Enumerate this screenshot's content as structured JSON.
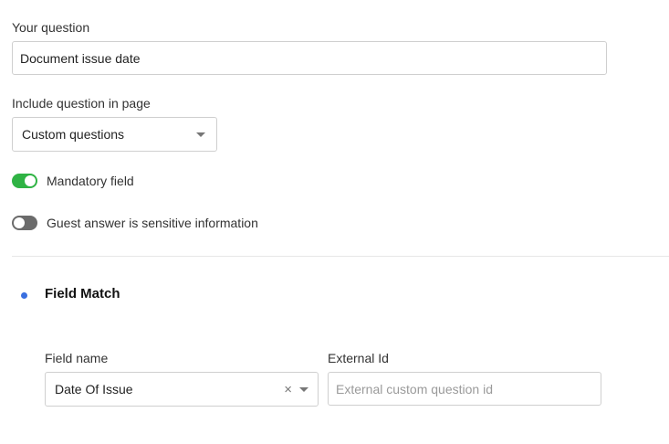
{
  "question": {
    "label": "Your question",
    "value": "Document issue date"
  },
  "include_page": {
    "label": "Include question in page",
    "selected": "Custom questions"
  },
  "toggles": {
    "mandatory": {
      "label": "Mandatory field",
      "on": true
    },
    "sensitive": {
      "label": "Guest answer is sensitive information",
      "on": false
    }
  },
  "field_match": {
    "title": "Field Match",
    "field_name": {
      "label": "Field name",
      "selected": "Date Of Issue",
      "clear_symbol": "×"
    },
    "external_id": {
      "label": "External Id",
      "value": "",
      "placeholder": "External custom question id"
    }
  },
  "colors": {
    "toggle_on": "#2fb344",
    "toggle_off": "#6b6b6b",
    "bullet": "#3a6fe0"
  }
}
